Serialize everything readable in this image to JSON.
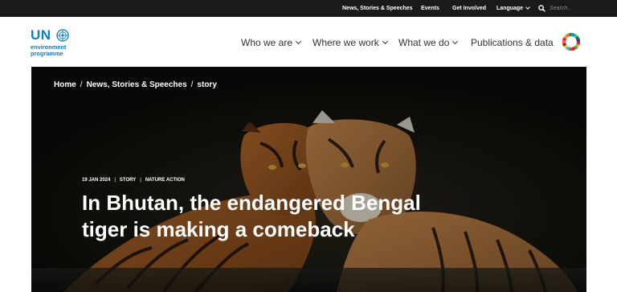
{
  "topbar": {
    "links": [
      "News, Stories & Speeches",
      "Events",
      "Get Involved"
    ],
    "language_label": "Language",
    "search_placeholder": "Search..."
  },
  "header": {
    "logo": {
      "primary": "UN",
      "line1": "environment",
      "line2": "programme"
    },
    "nav": [
      "Who we are",
      "Where we work",
      "What we do",
      "Publications & data"
    ]
  },
  "hero": {
    "breadcrumb": [
      "Home",
      "News, Stories & Speeches",
      "story"
    ],
    "meta": [
      "19 JAN 2024",
      "STORY",
      "NATURE ACTION"
    ],
    "headline_line1": "In Bhutan, the endangered Bengal",
    "headline_line2": "tiger is making a comeback"
  },
  "colors": {
    "topbar_bg": "#1a1a1a",
    "brand_blue": "#0a7ec2",
    "hero_bg": "#0d0f0c",
    "nav_text": "#333333"
  },
  "icons": [
    "un-emblem-icon",
    "chevron-down-icon",
    "search-icon",
    "sdg-wheel-icon"
  ]
}
